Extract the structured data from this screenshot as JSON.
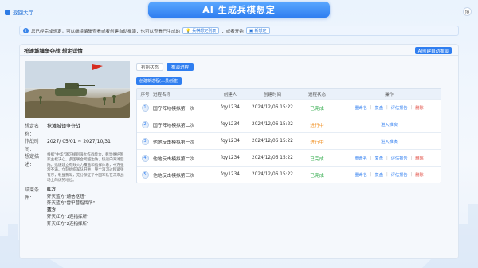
{
  "header": {
    "back_label": "返回大厅",
    "title": "AI 生成兵棋想定",
    "user_initial": "博"
  },
  "notice": {
    "text1": "您已经完成想定，可以继续编辑查看或者创建自动推演；也可以查看已生成的",
    "btn1": "兵棋想定列表",
    "text2": "；或者开始",
    "btn2": "新想定"
  },
  "panel": {
    "title": "抢滩城镇争夺战 想定详情",
    "auto_button": "AI创建自动推演"
  },
  "scenario": {
    "labels": {
      "name": "想定名称：",
      "time": "作战时间：",
      "desc": "想定描述：",
      "end": "结束条件："
    },
    "name": "抢滩城镇争夺战",
    "time": "2027/ 05/01 ~ 2027/10/31",
    "description": "根据\"中华\"演习规则强大作战能力，彰显维护国家主权决心，多国联合跨越边防，快速向海滩登陆，迅速建立有效火力覆盖和指挥体系，中方强烈不满，立刻组织军队开进，整个演习过程紧张有序，彰显我军，充分保证了中国军队在未来战场上的优势地位。",
    "end_conditions": [
      "红方",
      "歼灭蓝方\"通信枢纽\"",
      "歼灭蓝方\"雷甲营指挥所\"",
      "蓝方",
      "歼灭红方\"1连指挥所\"",
      "歼灭红方\"2连指挥所\""
    ]
  },
  "tabs": [
    "初始状态",
    "推演进程"
  ],
  "create_button": "创建新进程(人员创建)",
  "table": {
    "headers": [
      "序号",
      "进程名称",
      "创建人",
      "创建时间",
      "进程状态",
      "操作"
    ],
    "rows": [
      {
        "no": "1",
        "name": "国守阵地模拟第一次",
        "creator": "fqy1234",
        "time": "2024/12/06 15:22",
        "status": "已完成",
        "status_type": "done",
        "ops": [
          "重命名",
          "复盘",
          "评估报告",
          "删除"
        ]
      },
      {
        "no": "2",
        "name": "国守阵地模拟第二次",
        "creator": "fqy1234",
        "time": "2024/12/06 15:22",
        "status": "进行中",
        "status_type": "run",
        "ops": [
          "进入推演"
        ]
      },
      {
        "no": "3",
        "name": "他地反击模拟第一次",
        "creator": "fqy1234",
        "time": "2024/12/06 15:22",
        "status": "进行中",
        "status_type": "run",
        "ops": [
          "进入推演"
        ]
      },
      {
        "no": "4",
        "name": "他地反击模拟第二次",
        "creator": "fqy1234",
        "time": "2024/12/06 15:22",
        "status": "已完成",
        "status_type": "done",
        "ops": [
          "重命名",
          "复盘",
          "评估报告",
          "删除"
        ]
      },
      {
        "no": "5",
        "name": "他地反击模拟第三次",
        "creator": "fqy1234",
        "time": "2024/12/06 15:22",
        "status": "已完成",
        "status_type": "done",
        "ops": [
          "重命名",
          "复盘",
          "评估报告",
          "删除"
        ]
      }
    ]
  },
  "colors": {
    "accent": "#2f7ef0",
    "done": "#2aa845",
    "running": "#f08c1a",
    "delete": "#e0483e"
  }
}
